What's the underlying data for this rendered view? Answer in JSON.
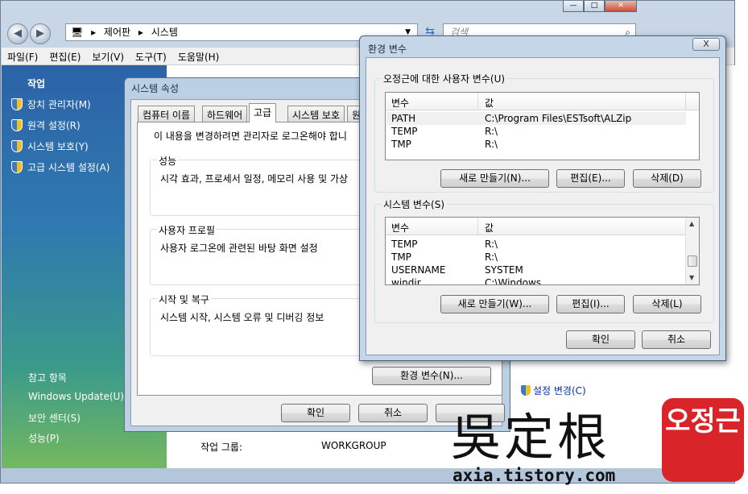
{
  "explorer": {
    "breadcrumb": [
      "제어판",
      "시스템"
    ],
    "search_placeholder": "검색",
    "menu": [
      "파일(F)",
      "편집(E)",
      "보기(V)",
      "도구(T)",
      "도움말(H)"
    ],
    "sidebar": {
      "tasks_header": "작업",
      "tasks": [
        "장치 관리자(M)",
        "원격 설정(R)",
        "시스템 보호(Y)",
        "고급 시스템 설정(A)"
      ],
      "see_also_header": "참고 항목",
      "see_also": [
        "Windows Update(U)",
        "보안 센터(S)",
        "성능(P)"
      ]
    },
    "workgroup_label": "작업 그룹:",
    "workgroup_value": "WORKGROUP",
    "change_settings_link": "설정 변경(C)"
  },
  "system_properties": {
    "title": "시스템 속성",
    "tabs": [
      "컴퓨터 이름",
      "하드웨어",
      "고급",
      "시스템 보호",
      "원"
    ],
    "active_tab": "고급",
    "admin_note": "이 내용을 변경하려면 관리자로 로그온해야 합니",
    "groups": [
      {
        "title": "성능",
        "desc": "시각 효과, 프로세서 일정, 메모리 사용 및 가상"
      },
      {
        "title": "사용자 프로필",
        "desc": "사용자 로그온에 관련된 바탕 화면 설정"
      },
      {
        "title": "시작 및 복구",
        "desc": "시스템 시작, 시스템 오류 및 디버깅 정보"
      }
    ],
    "env_button": "환경 변수(N)...",
    "ok": "확인",
    "cancel": "취소"
  },
  "env_dialog": {
    "title": "환경 변수",
    "close_glyph": "X",
    "user_vars": {
      "title": "오정근에 대한 사용자 변수(U)",
      "col_var": "변수",
      "col_val": "값",
      "rows": [
        {
          "name": "PATH",
          "value": "C:\\Program Files\\ESTsoft\\ALZip"
        },
        {
          "name": "TEMP",
          "value": "R:\\"
        },
        {
          "name": "TMP",
          "value": "R:\\"
        }
      ],
      "new_btn": "새로 만들기(N)...",
      "edit_btn": "편집(E)...",
      "delete_btn": "삭제(D)"
    },
    "system_vars": {
      "title": "시스템 변수(S)",
      "col_var": "변수",
      "col_val": "값",
      "rows": [
        {
          "name": "TEMP",
          "value": "R:\\"
        },
        {
          "name": "TMP",
          "value": "R:\\"
        },
        {
          "name": "USERNAME",
          "value": "SYSTEM"
        },
        {
          "name": "windir",
          "value": "C:\\Windows"
        }
      ],
      "new_btn": "새로 만들기(W)...",
      "edit_btn": "편집(I)...",
      "delete_btn": "삭제(L)"
    },
    "ok": "확인",
    "cancel": "취소"
  },
  "watermark": {
    "chinese": "吳定根",
    "url": "axia.tistory.com",
    "seal": "오정근"
  }
}
